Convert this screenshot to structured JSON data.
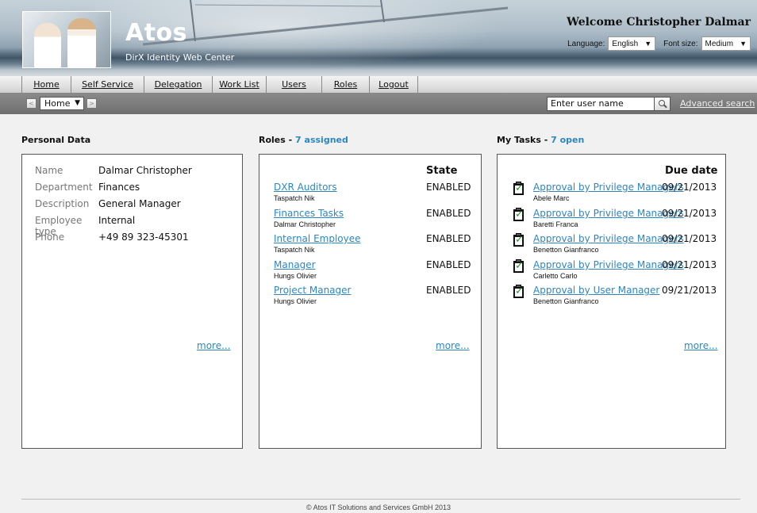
{
  "header": {
    "logo": "Atos",
    "app_name": "DirX Identity Web Center",
    "welcome": "Welcome Christopher Dalmar",
    "language_label": "Language:",
    "language_value": "English",
    "fontsize_label": "Font size:",
    "fontsize_value": "Medium"
  },
  "menu": {
    "items": [
      {
        "label": "Home"
      },
      {
        "label": "Self Service"
      },
      {
        "label": "Delegation"
      },
      {
        "label": "Work List"
      },
      {
        "label": "Users"
      },
      {
        "label": "Roles"
      },
      {
        "label": "Logout"
      }
    ]
  },
  "toolbar": {
    "back_glyph": "<",
    "forward_glyph": ">",
    "home_select": "Home",
    "user_input_value": "Enter user name",
    "advanced_search": "Advanced search"
  },
  "personal": {
    "title": "Personal Data",
    "rows": [
      {
        "label": "Name",
        "value": "Dalmar Christopher"
      },
      {
        "label": "Department",
        "value": "Finances"
      },
      {
        "label": "Description",
        "value": "General Manager"
      },
      {
        "label": "Employee type",
        "value": "Internal"
      },
      {
        "label": "Phone",
        "value": "+49 89 323-45301"
      }
    ],
    "more": "more..."
  },
  "roles": {
    "title": "Roles",
    "separator": " - ",
    "count_text": "7 assigned",
    "state_header": "State",
    "items": [
      {
        "name": "DXR Auditors",
        "owner": "Taspatch Nik",
        "state": "ENABLED"
      },
      {
        "name": "Finances Tasks",
        "owner": "Dalmar Christopher",
        "state": "ENABLED"
      },
      {
        "name": "Internal Employee",
        "owner": "Taspatch Nik",
        "state": "ENABLED"
      },
      {
        "name": "Manager",
        "owner": "Hungs Olivier",
        "state": "ENABLED"
      },
      {
        "name": "Project Manager",
        "owner": "Hungs Olivier",
        "state": "ENABLED"
      }
    ],
    "more": "more..."
  },
  "tasks": {
    "title": "My Tasks",
    "separator": " - ",
    "count_text": "7 open",
    "due_header": "Due date",
    "items": [
      {
        "name": "Approval by Privilege Managers",
        "person": "Abele Marc",
        "due": "09/21/2013"
      },
      {
        "name": "Approval by Privilege Managers",
        "person": "Baretti Franca",
        "due": "09/21/2013"
      },
      {
        "name": "Approval by Privilege Managers",
        "person": "Benetton Gianfranco",
        "due": "09/21/2013"
      },
      {
        "name": "Approval by Privilege Managers",
        "person": "Carletto Carlo",
        "due": "09/21/2013"
      },
      {
        "name": "Approval by User Manager",
        "person": "Benetton Gianfranco",
        "due": "09/21/2013"
      }
    ],
    "more": "more..."
  },
  "footer": {
    "copyright": "© Atos IT Solutions and Services GmbH 2013"
  },
  "colors": {
    "link": "#2e86c1",
    "toolbar": "#7a7a7a",
    "menubar": "#e1e1e1"
  }
}
